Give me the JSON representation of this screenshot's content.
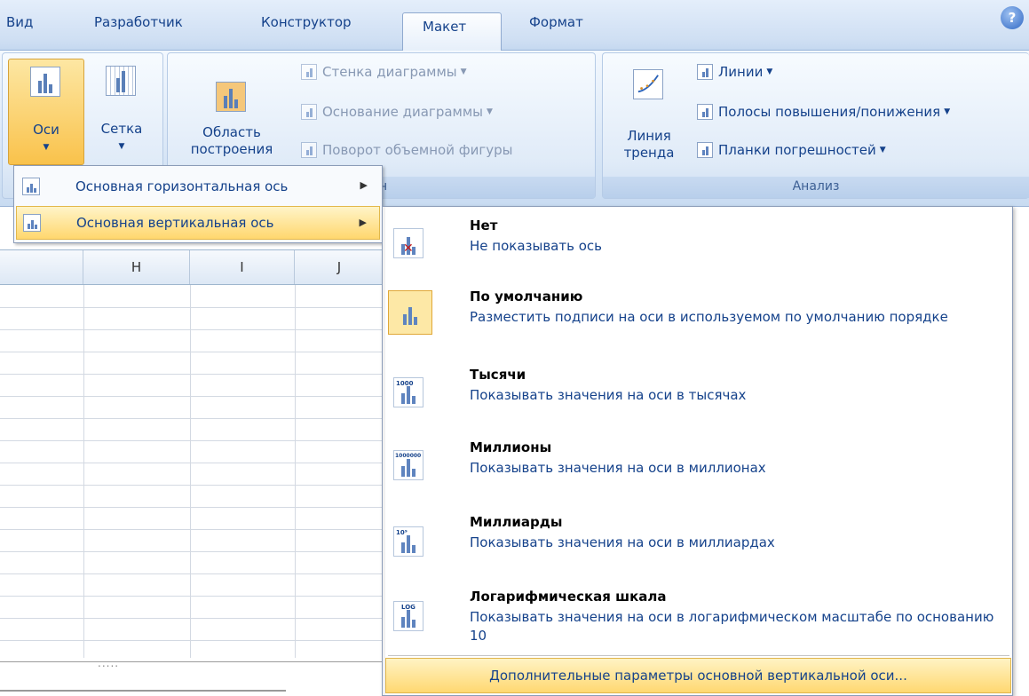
{
  "tabs": [
    {
      "label": "Вид"
    },
    {
      "label": "Разработчик"
    },
    {
      "label": "Конструктор"
    },
    {
      "label": "Макет"
    },
    {
      "label": "Формат"
    }
  ],
  "help_glyph": "?",
  "ribbon": {
    "axes_label": "Оси",
    "grid_label": "Сетка",
    "plot_area_label_line1": "Область",
    "plot_area_label_line2": "построения",
    "background_items": [
      "Стенка диаграммы",
      "Основание диаграммы",
      "Поворот объемной фигуры"
    ],
    "background_group_partial": "н",
    "trendline_line1": "Линия",
    "trendline_line2": "тренда",
    "analysis_items": [
      "Линии",
      "Полосы повышения/понижения",
      "Планки погрешностей"
    ],
    "analysis_group": "Анализ"
  },
  "sheet": {
    "columns": [
      "H",
      "I",
      "J"
    ],
    "dots": "....."
  },
  "menu1": {
    "horizontal": "Основная горизонтальная ось",
    "vertical": "Основная вертикальная ось"
  },
  "submenu": {
    "options": [
      {
        "title": "Нет",
        "desc": "Не показывать ось",
        "icon": "axis-none-icon"
      },
      {
        "title": "По умолчанию",
        "desc": "Разместить подписи на оси в используемом по умолчанию порядке",
        "icon": "axis-default-icon"
      },
      {
        "title": "Тысячи",
        "desc": "Показывать значения на оси в тысячах",
        "icon": "axis-thousands-icon",
        "icon_text": "1000"
      },
      {
        "title": "Миллионы",
        "desc": "Показывать значения на оси в миллионах",
        "icon": "axis-millions-icon",
        "icon_text": "1000000"
      },
      {
        "title": "Миллиарды",
        "desc": "Показывать значения на оси в миллиардах",
        "icon": "axis-billions-icon",
        "icon_text": "10⁹"
      },
      {
        "title": "Логарифмическая шкала",
        "desc": "Показывать значения на оси в логарифмическом масштабе по основанию 10",
        "icon": "axis-log-icon",
        "icon_text": "LOG"
      }
    ],
    "more": "Дополнительные параметры основной вертикальной оси..."
  }
}
